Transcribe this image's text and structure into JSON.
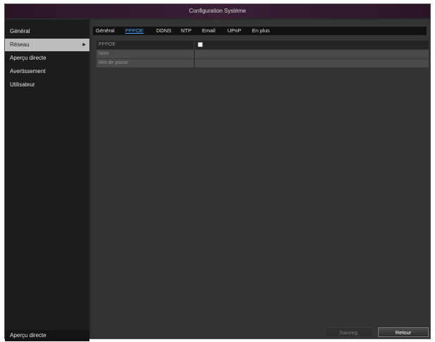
{
  "window": {
    "title": "Configuration Système"
  },
  "sidebar": {
    "items": [
      {
        "label": "Général",
        "active": false
      },
      {
        "label": "Réseau",
        "active": true
      },
      {
        "label": "Aperçu directe",
        "active": false
      },
      {
        "label": "Avertissement",
        "active": false
      },
      {
        "label": "Utilisateur",
        "active": false
      }
    ],
    "active_arrow": "▶",
    "bottom_label": "Aperçu directe"
  },
  "tabs": [
    {
      "label": "Général",
      "active": false
    },
    {
      "label": "PPPOE",
      "active": true
    },
    {
      "label": "DDNS",
      "active": false
    },
    {
      "label": "NTP",
      "active": false
    },
    {
      "label": "Email",
      "active": false
    },
    {
      "label": "UPnP",
      "active": false
    },
    {
      "label": "En plus",
      "active": false
    }
  ],
  "form": {
    "rows": [
      {
        "label": "PPPOE",
        "type": "checkbox",
        "checked": false
      },
      {
        "label": "Nom",
        "type": "text",
        "value": ""
      },
      {
        "label": "Mot de passe",
        "type": "text",
        "value": ""
      }
    ]
  },
  "buttons": {
    "save": "Sauveg.",
    "back": "Retour"
  },
  "colors": {
    "active_tab": "#4aa3ff",
    "title_bar": "#3a1f36"
  }
}
